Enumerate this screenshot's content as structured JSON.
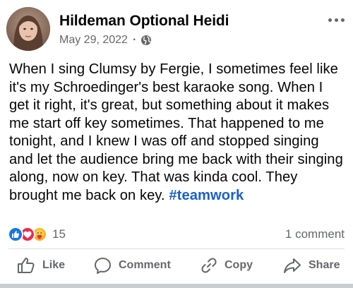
{
  "post": {
    "author": "Hildeman Optional Heidi",
    "date": "May 29, 2022",
    "separator": "·",
    "audience_icon": "globe-icon",
    "menu_icon": "more-options-icon",
    "text": "When I sing Clumsy by Fergie, I sometimes feel like it's my Schroedinger's best karaoke song. When I get it right, it's great, but something about it makes me start off key sometimes. That happened to me tonight, and I knew I was off and stopped singing and let the audience bring me back with their singing along, now on key. That was kinda cool. They brought me back on key. ",
    "hashtag": "#teamwork"
  },
  "stats": {
    "reactions": [
      "like",
      "love",
      "care"
    ],
    "reaction_count": "15",
    "comments": "1 comment"
  },
  "actions": {
    "like": "Like",
    "comment": "Comment",
    "copy": "Copy",
    "share": "Share"
  },
  "colors": {
    "text": "#050505",
    "secondary": "#65676b",
    "link": "#1a60c7",
    "like_blue": "#1b74e4",
    "love_red": "#f0284a",
    "care_yellow": "#f7b125"
  }
}
